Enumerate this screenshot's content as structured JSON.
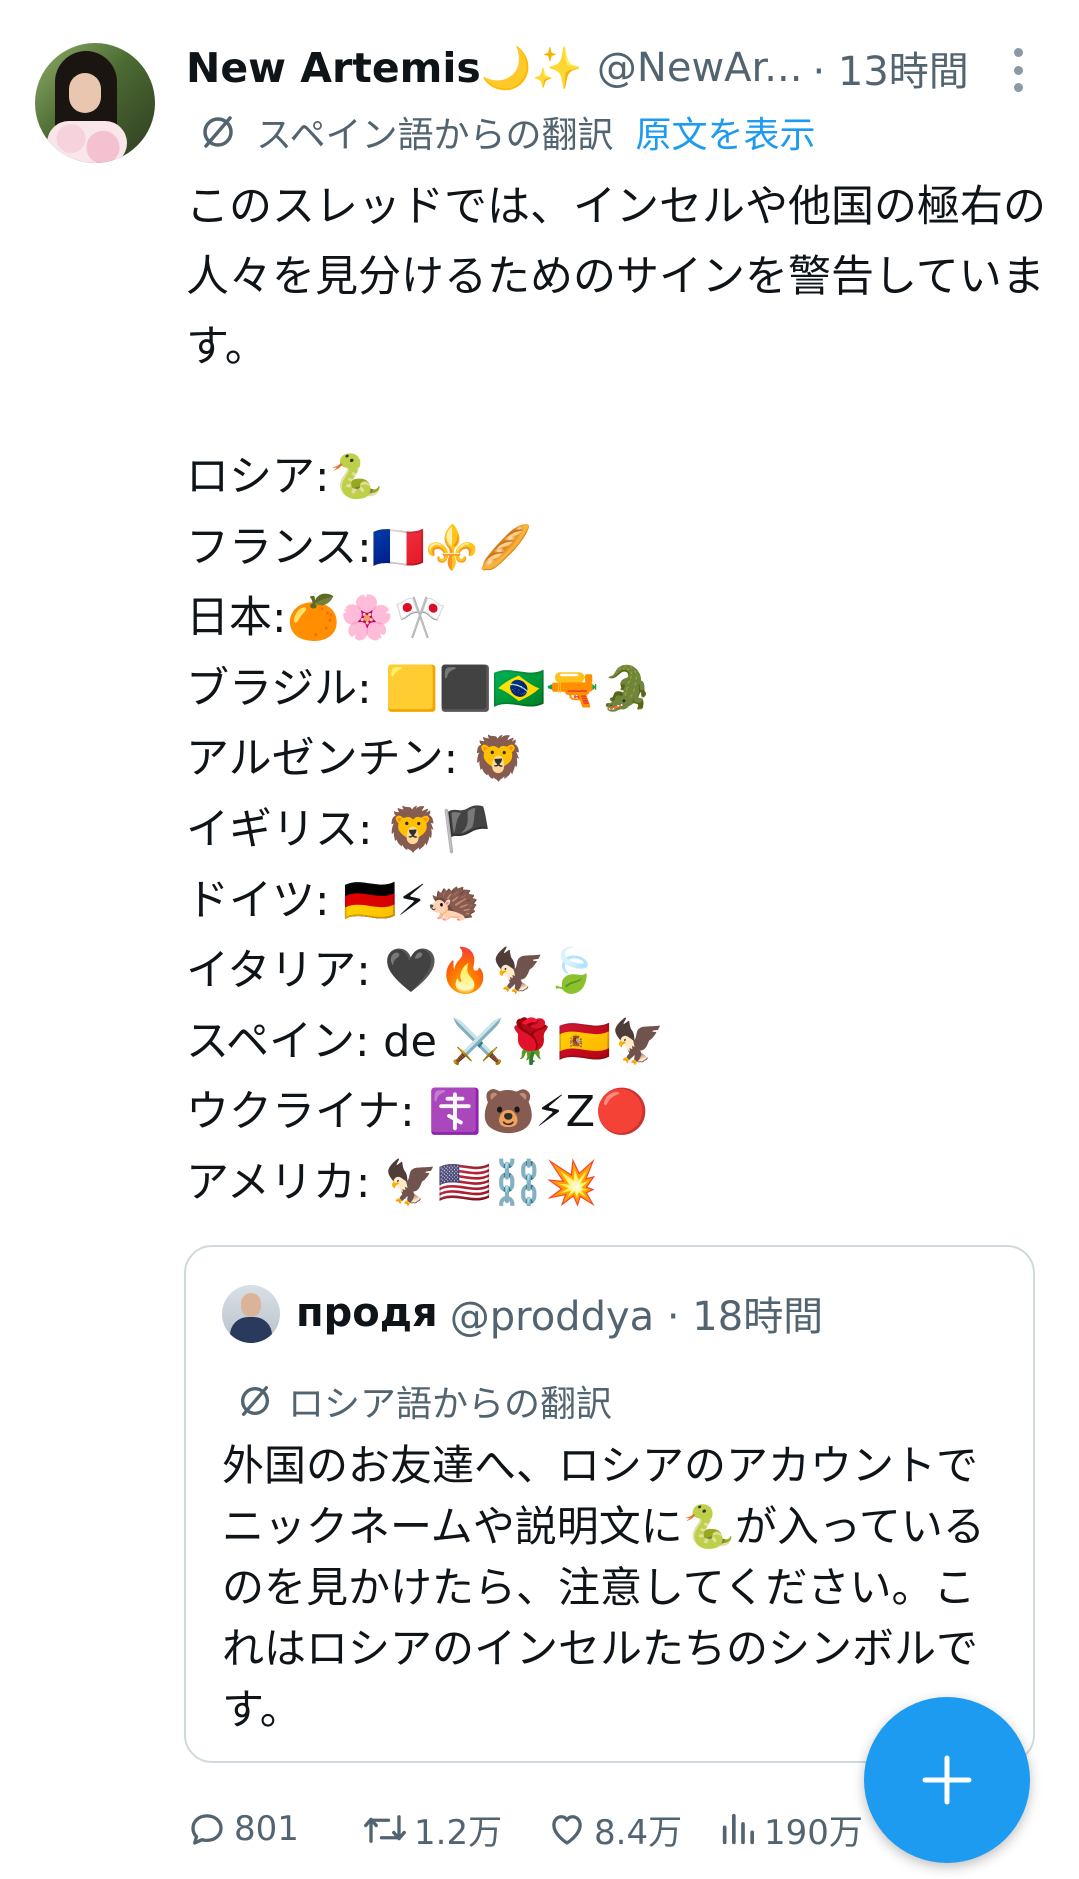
{
  "tweet": {
    "author_name": "New Artemis🌙✨",
    "author_handle": "@NewAr...",
    "time": "· 13時間",
    "translation_label": "スペイン語からの翻訳",
    "show_original": "原文を表示",
    "intro_text": "このスレッドでは、インセルや他国の極右の人々を見分けるためのサインを警告しています。",
    "signs": [
      "ロシア:🐍",
      "フランス:🇫🇷⚜️🥖",
      "日本:🍊🌸🎌",
      "ブラジル: 🟨⬛🇧🇷🔫🐊",
      "アルゼンチン: 🦁",
      "イギリス: 🦁🏴",
      "ドイツ: 🇩🇪⚡🦔",
      "イタリア: 🖤🔥🦅🍃",
      "スペイン: de ⚔️🌹🇪🇸🦅",
      "ウクライナ: ☦️🐻⚡Z🔴",
      "アメリカ: 🦅🇺🇸⛓️💥"
    ]
  },
  "quote": {
    "author_name": "продя",
    "author_handle": "@proddya · 18時間",
    "translation_label": "ロシア語からの翻訳",
    "text": "外国のお友達へ、ロシアのアカウントでニックネームや説明文に🐍が入っているのを見かけたら、注意してください。これはロシアのインセルたちのシンボルです。"
  },
  "actions": {
    "replies": "801",
    "retweets": "1.2万",
    "likes": "8.4万",
    "views": "190万"
  },
  "icons": {
    "more": "more-vertical-icon",
    "translate": "translate-icon",
    "reply": "reply-icon",
    "retweet": "retweet-icon",
    "like": "heart-icon",
    "views": "views-bar-chart-icon",
    "compose": "plus-icon"
  },
  "colors": {
    "accent": "#1d9bf0",
    "text": "#0f1419",
    "secondary": "#536471"
  }
}
